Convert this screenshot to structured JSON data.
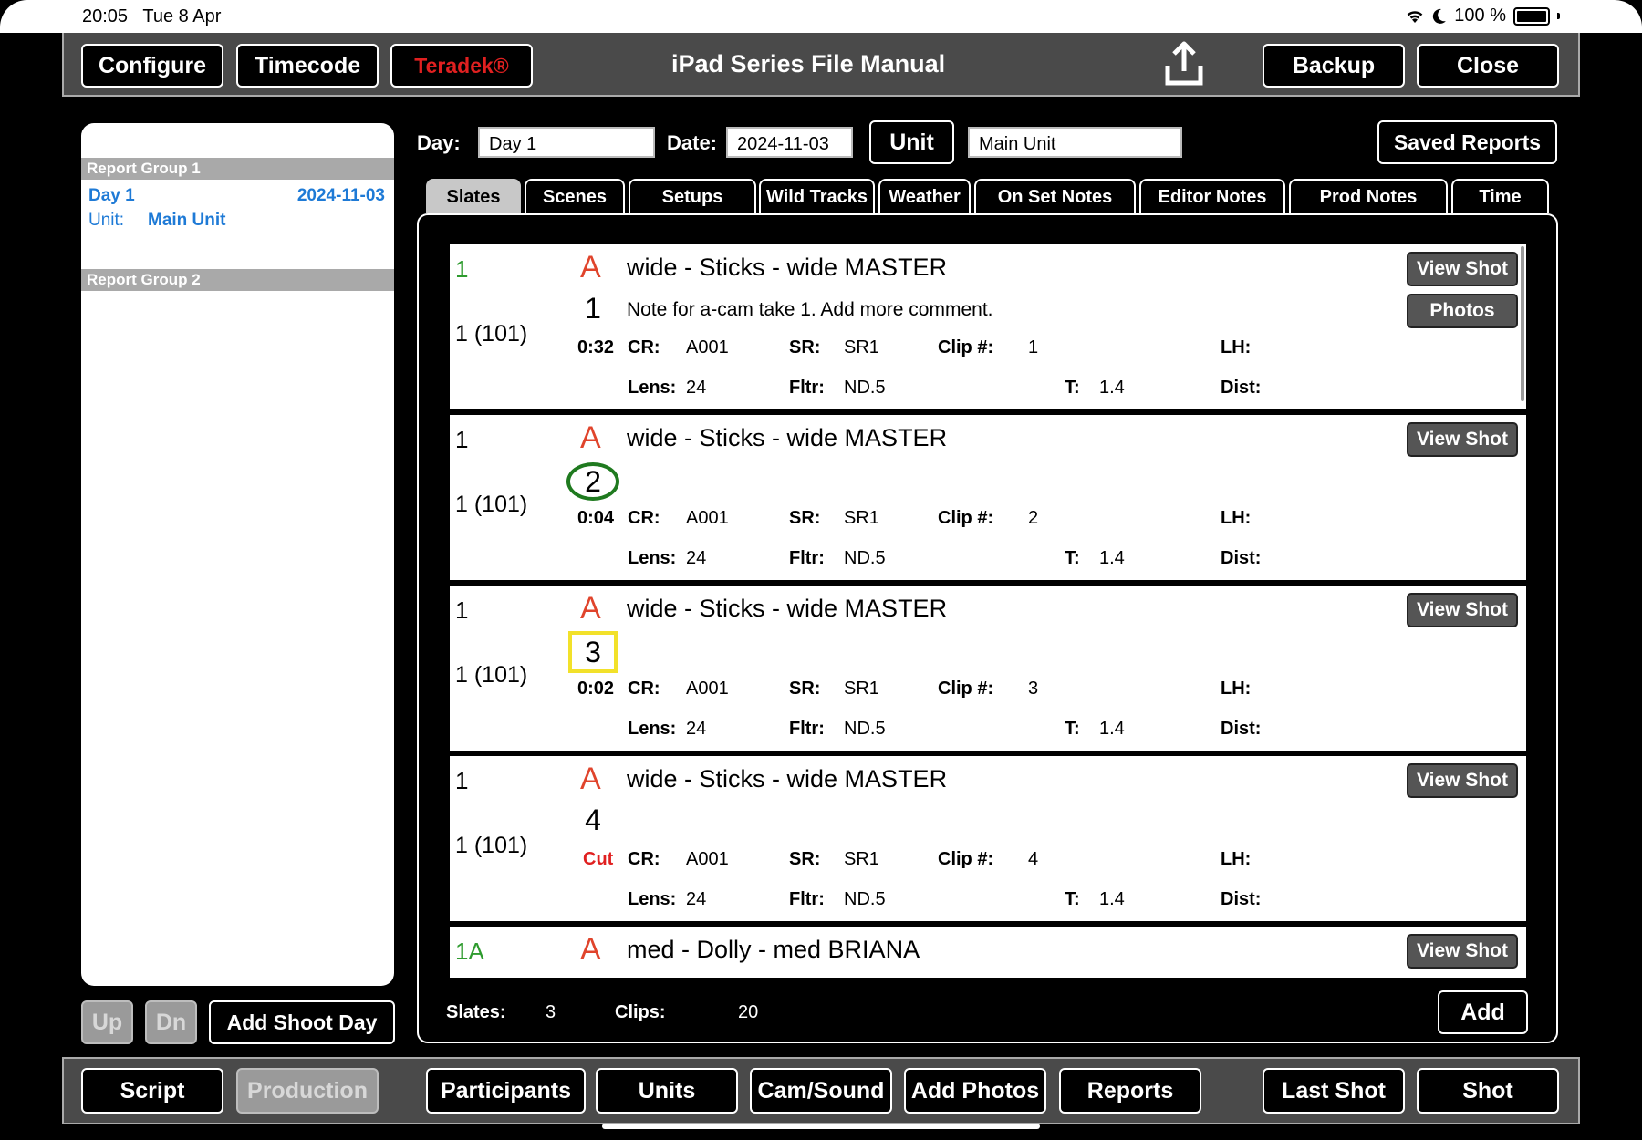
{
  "status": {
    "time": "20:05",
    "date": "Tue 8 Apr",
    "battery": "100 %"
  },
  "topbar": {
    "configure": "Configure",
    "timecode": "Timecode",
    "teradek": "Teradek®",
    "title": "iPad Series File Manual",
    "backup": "Backup",
    "close": "Close"
  },
  "sidebar": {
    "group1": "Report Group 1",
    "group2": "Report Group 2",
    "day": "Day 1",
    "day_date": "2024-11-03",
    "unit_label": "Unit:",
    "unit_value": "Main Unit",
    "up": "Up",
    "dn": "Dn",
    "add_day": "Add Shoot Day"
  },
  "form": {
    "day_label": "Day:",
    "day_value": "Day 1",
    "date_label": "Date:",
    "date_value": "2024-11-03",
    "unit_button": "Unit",
    "unit_value": "Main Unit",
    "saved_reports": "Saved Reports"
  },
  "tabs": [
    "Slates",
    "Scenes",
    "Setups",
    "Wild Tracks",
    "Weather",
    "On Set Notes",
    "Editor Notes",
    "Prod Notes",
    "Time"
  ],
  "labels": {
    "cr": "CR:",
    "sr": "SR:",
    "clip": "Clip #:",
    "lh": "LH:",
    "lens": "Lens:",
    "fltr": "Fltr:",
    "t": "T:",
    "dist": "Dist:",
    "view_shot": "View Shot",
    "photos": "Photos"
  },
  "rows": [
    {
      "scene": "1",
      "slate": "1 (101)",
      "cam": "A",
      "desc": "wide - Sticks - wide MASTER",
      "take": "1",
      "note": "Note for a-cam take 1. Add more comment.",
      "dur": "0:32",
      "cr": "A001",
      "sr": "SR1",
      "clip": "1",
      "lens": "24",
      "fltr": "ND.5",
      "t": "1.4"
    },
    {
      "scene": "1",
      "slate": "1 (101)",
      "cam": "A",
      "desc": "wide - Sticks - wide MASTER",
      "take": "2",
      "note": "",
      "dur": "0:04",
      "cr": "A001",
      "sr": "SR1",
      "clip": "2",
      "lens": "24",
      "fltr": "ND.5",
      "t": "1.4"
    },
    {
      "scene": "1",
      "slate": "1 (101)",
      "cam": "A",
      "desc": "wide - Sticks - wide MASTER",
      "take": "3",
      "note": "",
      "dur": "0:02",
      "cr": "A001",
      "sr": "SR1",
      "clip": "3",
      "lens": "24",
      "fltr": "ND.5",
      "t": "1.4"
    },
    {
      "scene": "1",
      "slate": "1 (101)",
      "cam": "A",
      "desc": "wide - Sticks - wide MASTER",
      "take": "4",
      "note": "",
      "dur": "Cut",
      "cr": "A001",
      "sr": "SR1",
      "clip": "4",
      "lens": "24",
      "fltr": "ND.5",
      "t": "1.4"
    },
    {
      "scene": "1A",
      "cam": "A",
      "desc": "med - Dolly - med BRIANA"
    }
  ],
  "footer": {
    "slates_label": "Slates:",
    "slates_value": "3",
    "clips_label": "Clips:",
    "clips_value": "20",
    "add": "Add"
  },
  "bottombar": {
    "script": "Script",
    "production": "Production",
    "participants": "Participants",
    "units": "Units",
    "camsound": "Cam/Sound",
    "add_photos": "Add Photos",
    "reports": "Reports",
    "last_shot": "Last Shot",
    "shot": "Shot"
  },
  "colors": {
    "take_circle": "#1f7a1f",
    "take_square": "#f2e12a",
    "camera_letter": "#e0442c",
    "scene_green": "#2e9b2e",
    "link_blue": "#1e7ad6"
  },
  "icons": {
    "wifi": "wifi-icon",
    "moon": "moon-icon",
    "battery": "battery-icon",
    "share": "share-icon"
  }
}
